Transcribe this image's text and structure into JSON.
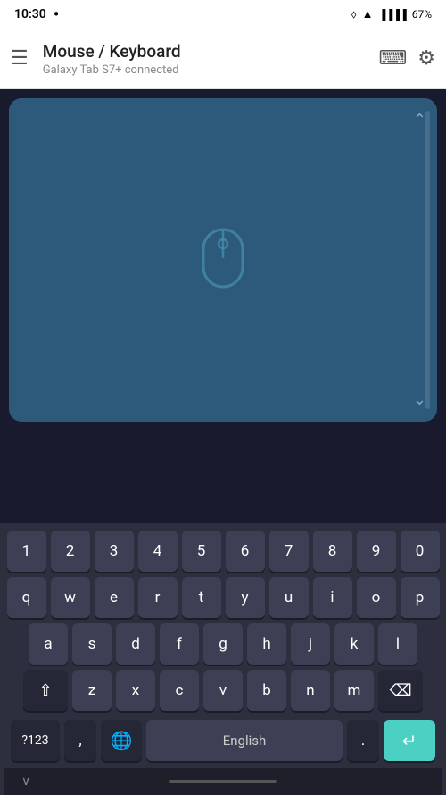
{
  "statusBar": {
    "time": "10:30",
    "battery": "67%",
    "batteryIcon": "🔋"
  },
  "appBar": {
    "title": "Mouse / Keyboard",
    "subtitle": "Galaxy Tab S7+ connected",
    "menuIcon": "☰",
    "keyboardIcon": "⌨",
    "settingsIcon": "⚙"
  },
  "touchpad": {
    "mouseIconLabel": "mouse-cursor"
  },
  "keyboard": {
    "row1": [
      "1",
      "2",
      "3",
      "4",
      "5",
      "6",
      "7",
      "8",
      "9",
      "0"
    ],
    "row2": [
      "q",
      "w",
      "e",
      "r",
      "t",
      "y",
      "u",
      "i",
      "o",
      "p"
    ],
    "row3": [
      "a",
      "s",
      "d",
      "f",
      "g",
      "h",
      "j",
      "k",
      "l"
    ],
    "row4": [
      "z",
      "x",
      "c",
      "v",
      "b",
      "n",
      "m"
    ],
    "bottomRow": {
      "numbers": "?123",
      "comma": ",",
      "language": "English",
      "period": ".",
      "enter": "↵"
    }
  }
}
